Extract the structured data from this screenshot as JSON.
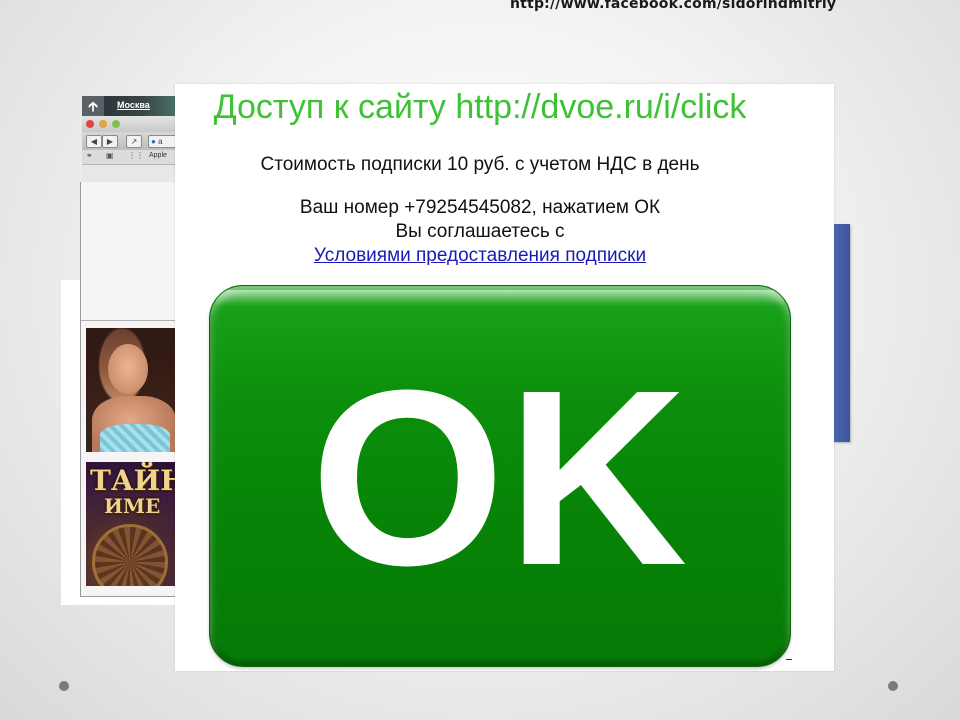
{
  "slide": {
    "header_url": "http://www.facebook.com/sidorindmitriy"
  },
  "background_browser": {
    "city": "Москва",
    "bookmark_apple": "Apple",
    "address_snippet": "a"
  },
  "background_ad": {
    "title_line1": "ТАЙН",
    "title_line2": "ИМЕ"
  },
  "popup": {
    "title": "Доступ к сайту http://dvoe.ru/i/click",
    "cost": "Стоимость подписки 10 руб. с учетом НДС в день",
    "number_line": "Ваш номер +79254545082, нажатием ОК",
    "agree_line": "Вы соглашаетесь с",
    "terms_link": "Условиями предоставления подписки",
    "ok_label": "OK"
  },
  "colors": {
    "title_green": "#3dc235",
    "ok_green": "#078407",
    "link_blue": "#1a1ab8",
    "fb_blue": "#3b5598"
  }
}
